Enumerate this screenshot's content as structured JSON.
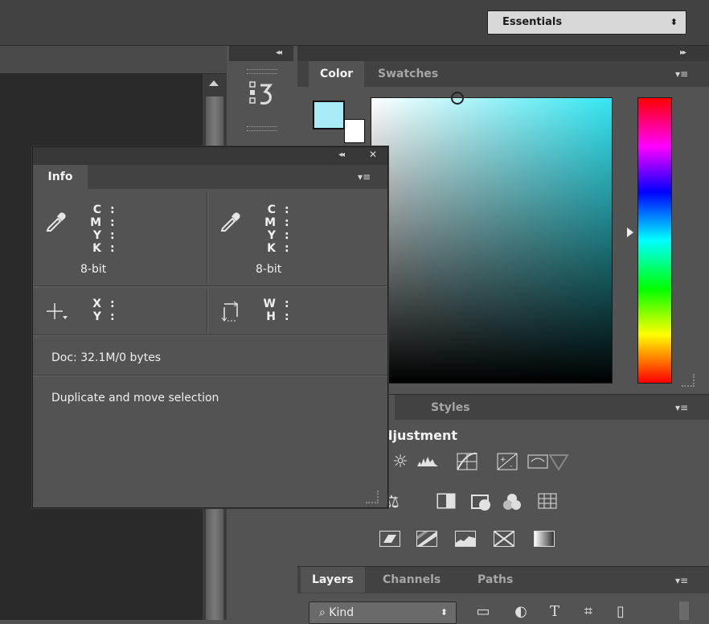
{
  "workspace": {
    "label": "Essentials",
    "arrows": "⬍"
  },
  "dock": {
    "collapse_left": "◂◂",
    "collapse_right": "▸▸",
    "panel_menu": "▾≡"
  },
  "mini_dock": {
    "history_icon": "history-icon"
  },
  "color_panel": {
    "tabs": [
      {
        "label": "Color",
        "active": true
      },
      {
        "label": "Swatches",
        "active": false
      }
    ],
    "foreground": "#a9ecf7",
    "background": "#ffffff",
    "field_hue": "#34e6f2"
  },
  "adjustments_panel": {
    "tabs": [
      {
        "label": "ts",
        "active": true
      },
      {
        "label": "Styles",
        "active": false
      }
    ],
    "title": "djustment"
  },
  "layers_panel": {
    "tabs": [
      {
        "label": "Layers",
        "active": true
      },
      {
        "label": "Channels",
        "active": false
      },
      {
        "label": "Paths",
        "active": false
      }
    ],
    "kind_label": "Kind",
    "kind_arrows": "⬍",
    "filter_icons": [
      "image-filter-icon",
      "adjustment-filter-icon",
      "type-filter-icon",
      "shape-filter-icon",
      "smart-object-filter-icon"
    ]
  },
  "info_panel": {
    "tab": "Info",
    "header_collapse": "◂◂",
    "header_close": "✕",
    "menu": "▾≡",
    "readout_left": {
      "labels": [
        "C",
        "M",
        "Y",
        "K"
      ],
      "bits": "8-bit"
    },
    "readout_right": {
      "labels": [
        "C",
        "M",
        "Y",
        "K"
      ],
      "bits": "8-bit"
    },
    "position": {
      "labels": [
        "X",
        "Y"
      ]
    },
    "size": {
      "labels": [
        "W",
        "H"
      ]
    },
    "doc": "Doc: 32.1M/0 bytes",
    "status": "Duplicate and move selection"
  },
  "colors": {
    "accent": "#34e6f2",
    "panel": "#535353",
    "header": "#383838"
  }
}
